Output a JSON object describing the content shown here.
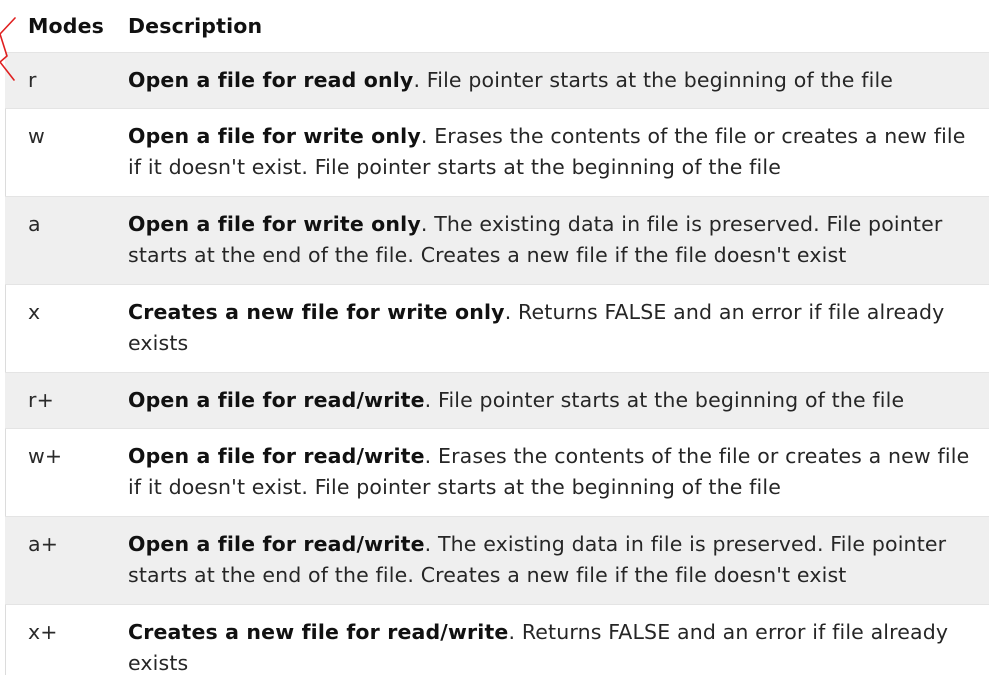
{
  "table": {
    "headers": {
      "mode": "Modes",
      "description": "Description"
    },
    "rows": [
      {
        "mode": "r",
        "bold": "Open a file for read only",
        "rest": ". File pointer starts at the beginning of the file"
      },
      {
        "mode": "w",
        "bold": "Open a file for write only",
        "rest": ". Erases the contents of the file or creates a new file if it doesn't exist. File pointer starts at the beginning of the file"
      },
      {
        "mode": "a",
        "bold": "Open a file for write only",
        "rest": ". The existing data in file is preserved. File pointer starts at the end of the file. Creates a new file if the file doesn't exist"
      },
      {
        "mode": "x",
        "bold": "Creates a new file for write only",
        "rest": ". Returns FALSE and an error if file already exists"
      },
      {
        "mode": "r+",
        "bold": "Open a file for read/write",
        "rest": ". File pointer starts at the beginning of the file"
      },
      {
        "mode": "w+",
        "bold": "Open a file for read/write",
        "rest": ". Erases the contents of the file or creates a new file if it doesn't exist. File pointer starts at the beginning of the file"
      },
      {
        "mode": "a+",
        "bold": "Open a file for read/write",
        "rest": ". The existing data in file is preserved. File pointer starts at the end of the file. Creates a new file if the file doesn't exist"
      },
      {
        "mode": "x+",
        "bold": "Creates a new file for read/write",
        "rest": ". Returns FALSE and an error if file already exists"
      }
    ]
  },
  "annotation": {
    "color": "#e02020"
  },
  "colors": {
    "row_shade": "#efefef",
    "row_plain": "#ffffff",
    "border": "#e4e4e4"
  }
}
